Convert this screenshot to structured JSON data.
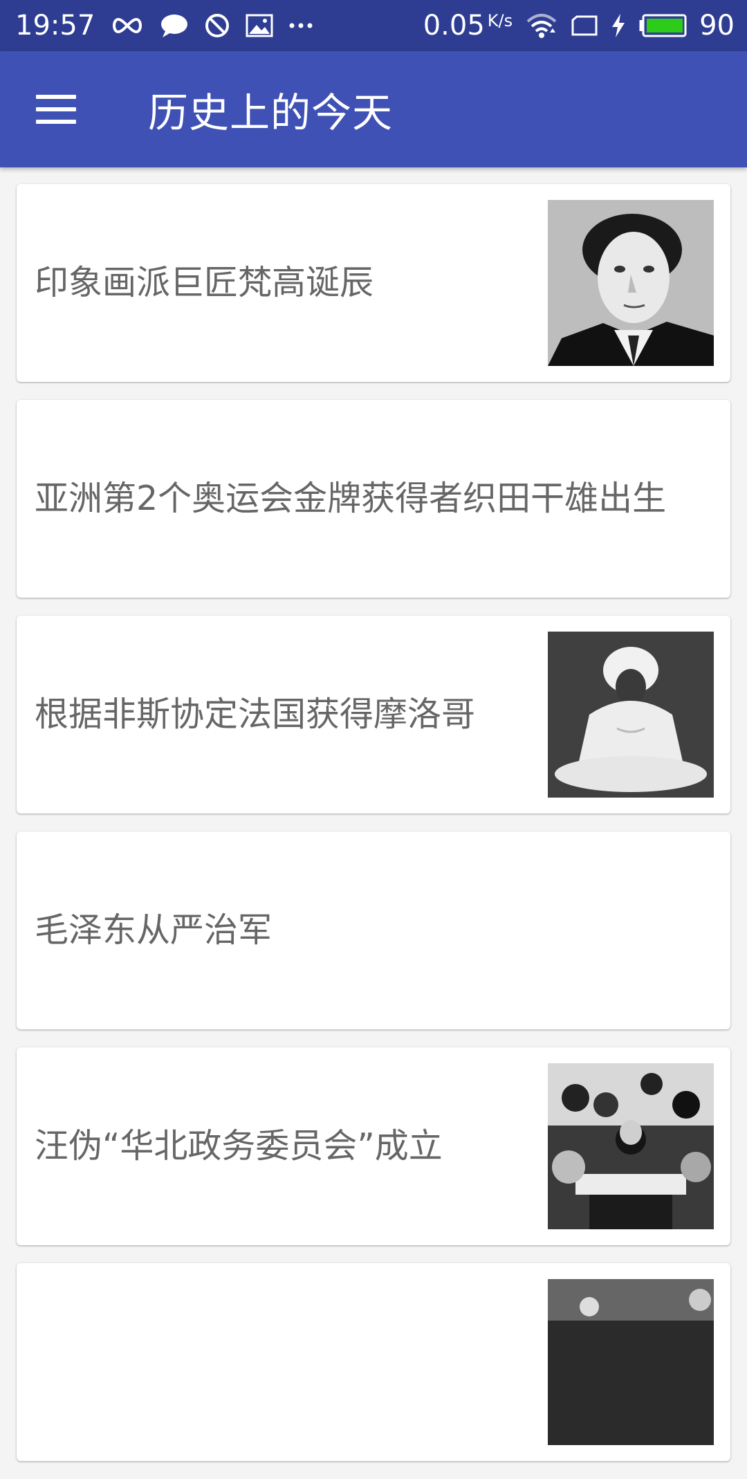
{
  "status_bar": {
    "time": "19:57",
    "speed": "0.05",
    "speed_unit": "K/s",
    "battery": "90",
    "icons": [
      "infinity-icon",
      "chat-bubble-icon",
      "block-icon",
      "image-icon",
      "more-dots-icon",
      "wifi-icon",
      "screen-icon",
      "charging-bolt-icon",
      "battery-icon"
    ]
  },
  "app_bar": {
    "title": "历史上的今天",
    "menu_icon": "hamburger-menu-icon"
  },
  "events": [
    {
      "title": "印象画派巨匠梵高诞辰",
      "has_image": true,
      "image_desc": "portrait-photo"
    },
    {
      "title": "亚洲第2个奥运会金牌获得者织田干雄出生",
      "has_image": false
    },
    {
      "title": "根据非斯协定法国获得摩洛哥",
      "has_image": true,
      "image_desc": "seated-figure-photo"
    },
    {
      "title": "毛泽东从严治军",
      "has_image": false
    },
    {
      "title": "汪伪“华北政务委员会”成立",
      "has_image": true,
      "image_desc": "group-photo"
    },
    {
      "title": "",
      "has_image": true,
      "image_desc": "partial-photo"
    }
  ],
  "colors": {
    "status_bar": "#2e3d92",
    "app_bar": "#3f51b5",
    "battery_fill": "#2ecc1a",
    "card_text": "#666666"
  }
}
